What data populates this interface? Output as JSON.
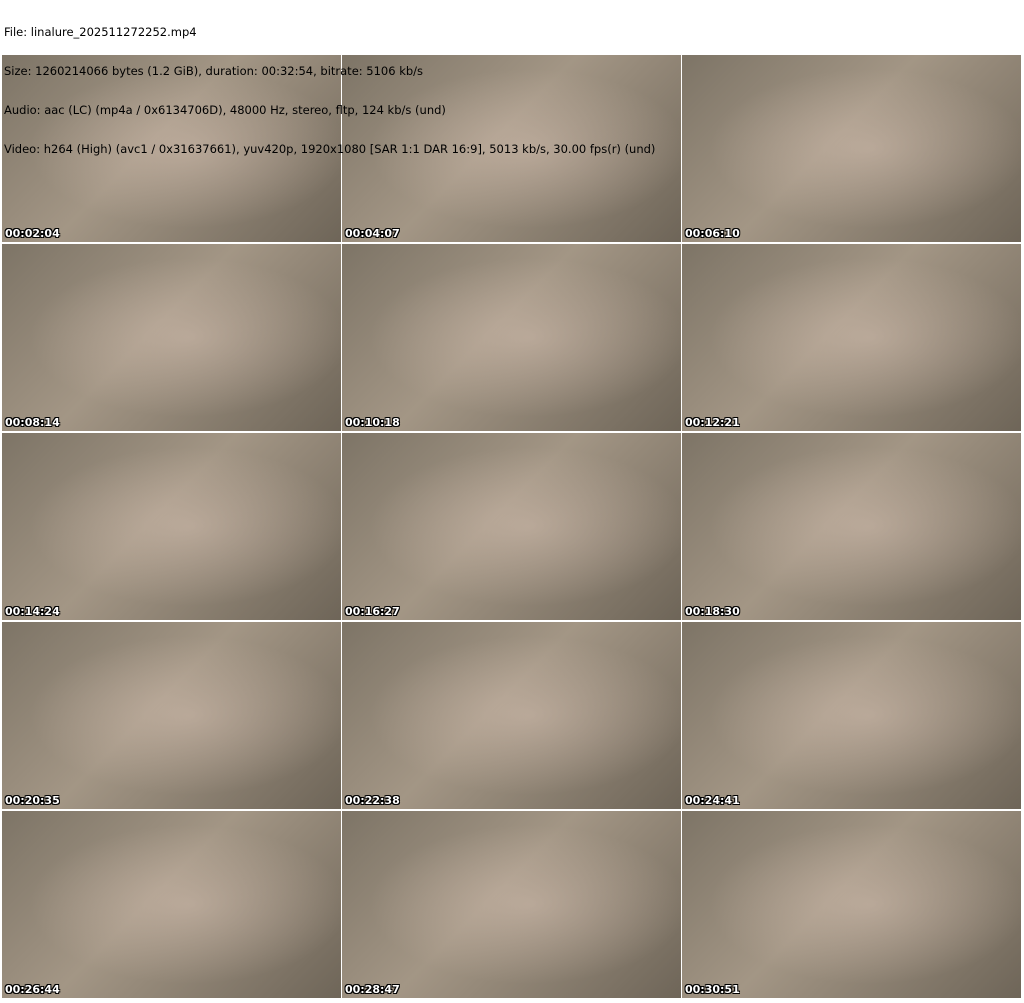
{
  "header": {
    "file": "File: linalure_202511272252.mp4",
    "size": "Size: 1260214066 bytes (1.2 GiB), duration: 00:32:54, bitrate: 5106 kb/s",
    "audio": "Audio: aac (LC) (mp4a / 0x6134706D), 48000 Hz, stereo, fltp, 124 kb/s (und)",
    "video": "Video: h264 (High) (avc1 / 0x31637661), yuv420p, 1920x1080 [SAR 1:1 DAR 16:9], 5013 kb/s, 30.00 fps(r) (und)"
  },
  "thumbnails": [
    "00:02:04",
    "00:04:07",
    "00:06:10",
    "00:08:14",
    "00:10:18",
    "00:12:21",
    "00:14:24",
    "00:16:27",
    "00:18:30",
    "00:20:35",
    "00:22:38",
    "00:24:41",
    "00:26:44",
    "00:28:47",
    "00:30:51"
  ]
}
